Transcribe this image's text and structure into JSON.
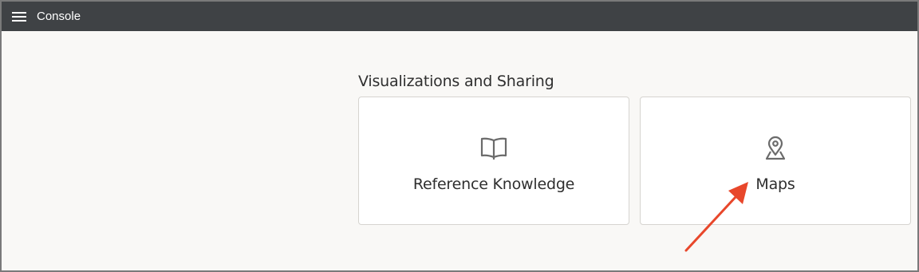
{
  "app": {
    "title": "Console"
  },
  "section": {
    "title": "Visualizations and Sharing"
  },
  "cards": [
    {
      "label": "Reference Knowledge",
      "icon": "book-icon"
    },
    {
      "label": "Maps",
      "icon": "map-pin-icon"
    }
  ],
  "colors": {
    "topbar": "#3f4245",
    "background": "#f9f8f6",
    "icon": "#6b6b6b",
    "annotation_arrow": "#e8472b"
  }
}
